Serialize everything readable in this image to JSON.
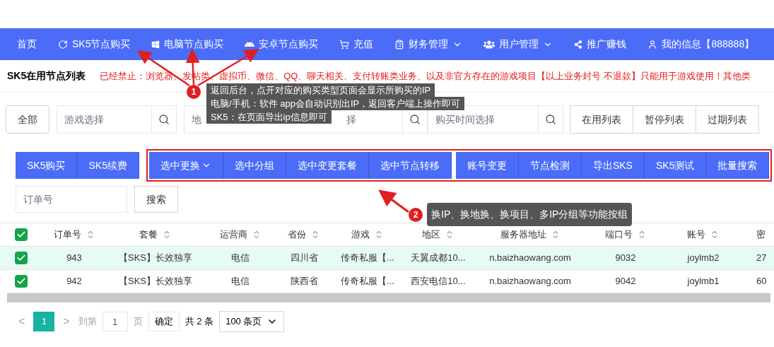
{
  "nav": {
    "items": [
      {
        "label": "首页",
        "dropdown": false
      },
      {
        "label": "SK5节点购买",
        "dropdown": false
      },
      {
        "label": "电脑节点购买",
        "dropdown": false
      },
      {
        "label": "安卓节点购买",
        "dropdown": false
      },
      {
        "label": "充值",
        "dropdown": false
      },
      {
        "label": "财务管理",
        "dropdown": true
      },
      {
        "label": "用户管理",
        "dropdown": true
      },
      {
        "label": "推广赚钱",
        "dropdown": false
      },
      {
        "label": "我的信息【888888】",
        "dropdown": false
      }
    ]
  },
  "subheader": {
    "title": "SK5在用节点列表",
    "notice": "已经禁止：浏览器、发帖类、虚拟币、微信、QQ、聊天相关、支付转账类业务、以及非官方存在的游戏项目【以上业务封号 不退款】只能用于游戏使用！其他类"
  },
  "filters": {
    "all_button": "全部",
    "game_placeholder": "游戏选择",
    "region_visible_start": "地",
    "region_visible_end": "择",
    "time_placeholder": "购买时间选择",
    "list_tabs": [
      {
        "label": "在用列表",
        "selected": false
      },
      {
        "label": "暂停列表",
        "selected": false
      },
      {
        "label": "过期列表",
        "selected": false
      }
    ]
  },
  "actions": {
    "group_1": [
      {
        "label": "SK5购买",
        "dropdown": false
      },
      {
        "label": "SK5续费",
        "dropdown": false
      }
    ],
    "group_2": [
      {
        "label": "选中更换",
        "dropdown": true
      },
      {
        "label": "选中分组",
        "dropdown": false
      },
      {
        "label": "选中变更套餐",
        "dropdown": false
      },
      {
        "label": "选中节点转移",
        "dropdown": false
      }
    ],
    "group_3": [
      {
        "label": "账号变更",
        "dropdown": false
      },
      {
        "label": "节点检测",
        "dropdown": false
      },
      {
        "label": "导出SKS",
        "dropdown": false
      },
      {
        "label": "SK5测试",
        "dropdown": false
      },
      {
        "label": "批量搜索",
        "dropdown": false
      }
    ]
  },
  "search": {
    "placeholder": "订单号",
    "button": "搜索"
  },
  "table": {
    "all_checked": true,
    "columns": [
      "订单号",
      "套餐",
      "运营商",
      "省份",
      "游戏",
      "地区",
      "服务器地址",
      "端口号",
      "账号",
      "密"
    ],
    "rows": [
      {
        "checked": true,
        "selected": true,
        "cells": [
          "943",
          "【SKS】长效独享",
          "电信",
          "四川省",
          "传奇私服【...",
          "天翼成都10...",
          "n.baizhaowang.com",
          "9032",
          "joylmb2",
          "27"
        ]
      },
      {
        "checked": true,
        "selected": false,
        "cells": [
          "942",
          "【SKS】长效独享",
          "电信",
          "陕西省",
          "传奇私服【...",
          "西安电信10...",
          "n.baizhaowang.com",
          "9042",
          "joylmb1",
          "60"
        ]
      }
    ]
  },
  "pagination": {
    "prev": "<",
    "pages": [
      {
        "label": "1",
        "selected": true
      }
    ],
    "next": ">",
    "goto_label": "到第",
    "goto_value": "1",
    "page_unit": "页",
    "confirm": "确定",
    "total": "共 2 条",
    "page_size": "100 条页"
  },
  "callouts": [
    {
      "badge": "1",
      "lines": [
        "返回后台，点开对应的购买类型页面会显示所购买的IP",
        "电脑/手机：软件 app会自动识别出IP，返回客户端上操作即可",
        "SK5：在页面导出ip信息即可"
      ]
    },
    {
      "badge": "2",
      "lines": [
        "换IP、换地换、换项目、多IP分组等功能按组"
      ]
    }
  ]
}
